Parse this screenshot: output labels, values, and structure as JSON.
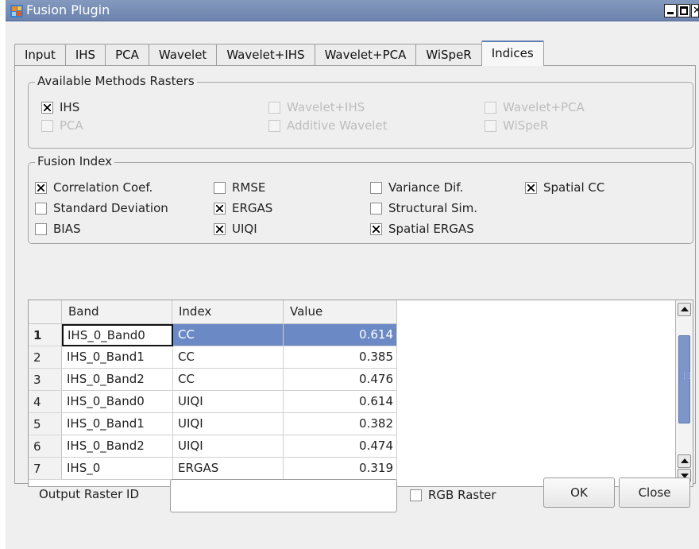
{
  "window": {
    "title": "Fusion Plugin"
  },
  "tabs": [
    "Input",
    "IHS",
    "PCA",
    "Wavelet",
    "Wavelet+IHS",
    "Wavelet+PCA",
    "WiSpeR",
    "Indices"
  ],
  "selected_tab": "Indices",
  "available_methods": {
    "title": "Available Methods Rasters",
    "items": [
      {
        "label": "IHS",
        "checked": true,
        "enabled": true
      },
      {
        "label": "Wavelet+IHS",
        "checked": false,
        "enabled": false
      },
      {
        "label": "Wavelet+PCA",
        "checked": false,
        "enabled": false
      },
      {
        "label": "PCA",
        "checked": false,
        "enabled": false
      },
      {
        "label": "Additive Wavelet",
        "checked": false,
        "enabled": false
      },
      {
        "label": "WiSpeR",
        "checked": false,
        "enabled": false
      }
    ]
  },
  "fusion_index": {
    "title": "Fusion Index",
    "items": [
      {
        "label": "Correlation Coef.",
        "checked": true
      },
      {
        "label": "RMSE",
        "checked": false
      },
      {
        "label": "Variance Dif.",
        "checked": false
      },
      {
        "label": "Spatial CC",
        "checked": true
      },
      {
        "label": "Standard Deviation",
        "checked": false
      },
      {
        "label": "ERGAS",
        "checked": true
      },
      {
        "label": "Structural Sim.",
        "checked": false
      },
      {
        "label": "BIAS",
        "checked": false
      },
      {
        "label": "UIQI",
        "checked": true
      },
      {
        "label": "Spatial ERGAS",
        "checked": true
      }
    ]
  },
  "results_table": {
    "columns": [
      "Band",
      "Index",
      "Value"
    ],
    "rows": [
      {
        "num": "1",
        "band": "IHS_0_Band0",
        "index": "CC",
        "value": "0.614"
      },
      {
        "num": "2",
        "band": "IHS_0_Band1",
        "index": "CC",
        "value": "0.385"
      },
      {
        "num": "3",
        "band": "IHS_0_Band2",
        "index": "CC",
        "value": "0.476"
      },
      {
        "num": "4",
        "band": "IHS_0_Band0",
        "index": "UIQI",
        "value": "0.614"
      },
      {
        "num": "5",
        "band": "IHS_0_Band1",
        "index": "UIQI",
        "value": "0.382"
      },
      {
        "num": "6",
        "band": "IHS_0_Band2",
        "index": "UIQI",
        "value": "0.474"
      },
      {
        "num": "7",
        "band": "IHS_0",
        "index": "ERGAS",
        "value": "0.319"
      }
    ]
  },
  "output": {
    "label": "Output Raster ID",
    "value": "",
    "rgb_label": "RGB Raster",
    "rgb_checked": false
  },
  "buttons": {
    "ok": "OK",
    "close": "Close"
  }
}
